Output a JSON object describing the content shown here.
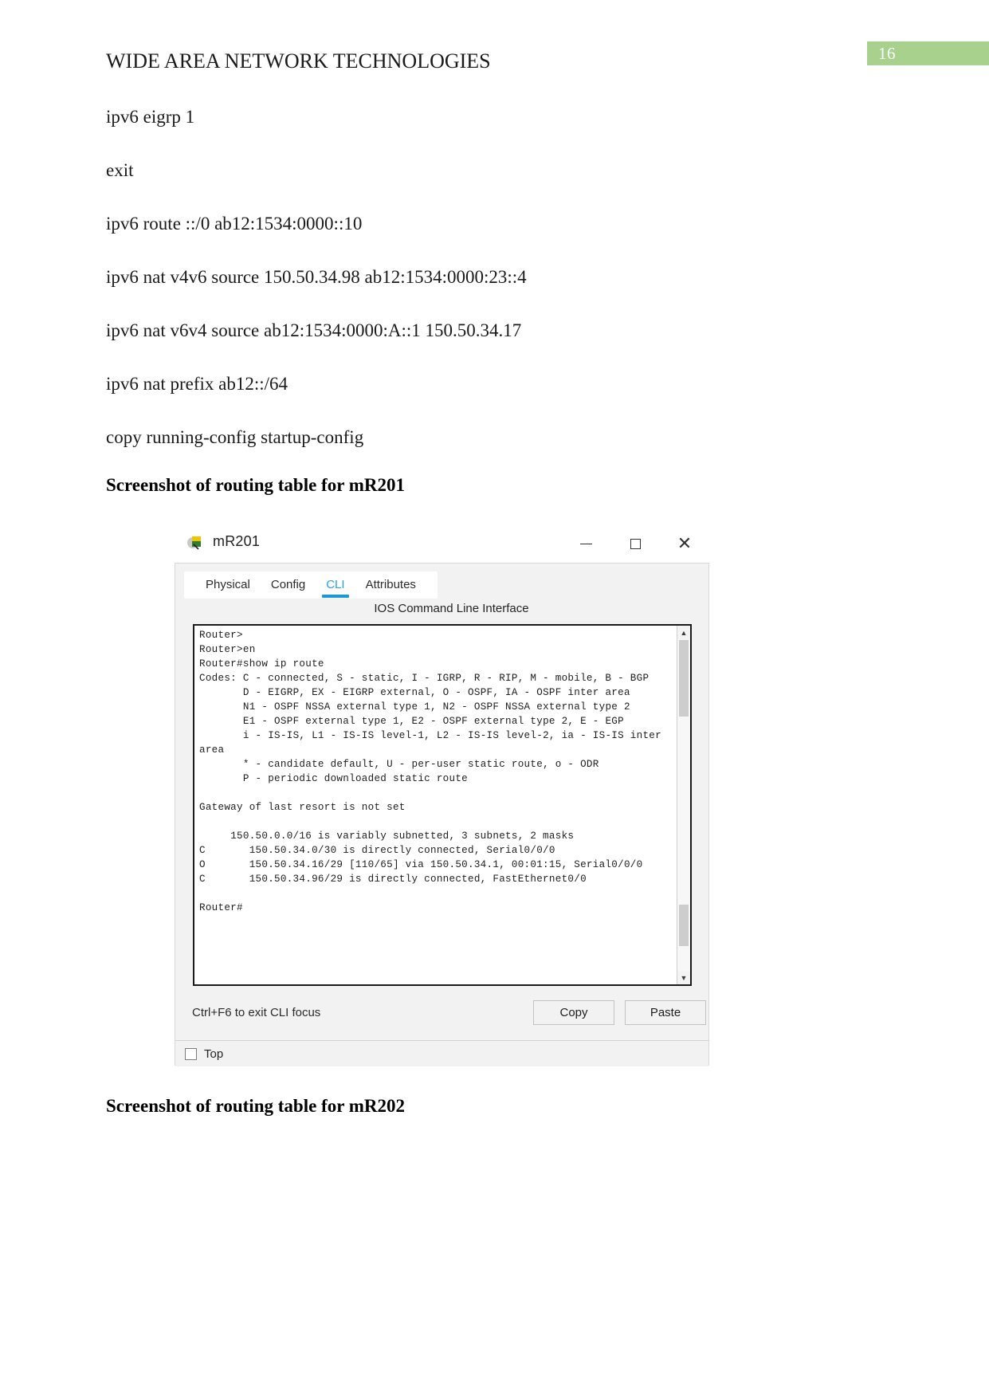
{
  "document": {
    "header_title": "WIDE AREA NETWORK TECHNOLOGIES",
    "page_number": "16",
    "page_number_bg": "#a9d18e",
    "config_lines": [
      "ipv6 eigrp 1",
      "exit",
      "ipv6 route ::/0 ab12:1534:0000::10",
      "ipv6 nat v4v6 source 150.50.34.98 ab12:1534:0000:23::4",
      "ipv6 nat v6v4 source ab12:1534:0000:A::1 150.50.34.17",
      "ipv6 nat prefix ab12::/64",
      "copy running-config startup-config"
    ],
    "heading_mr201": "Screenshot of routing table for mR201",
    "heading_mr202": "Screenshot of routing table for mR202"
  },
  "packet_tracer_window": {
    "title": "mR201",
    "app_icon": "packet-tracer-router-icon",
    "window_controls": {
      "minimize": "minimize-icon",
      "maximize": "maximize-icon",
      "close": "close-icon"
    },
    "tabs": [
      {
        "label": "Physical",
        "active": false
      },
      {
        "label": "Config",
        "active": false
      },
      {
        "label": "CLI",
        "active": true
      },
      {
        "label": "Attributes",
        "active": false
      }
    ],
    "subtitle": "IOS Command Line Interface",
    "terminal_text": "Router>\nRouter>en\nRouter#show ip route\nCodes: C - connected, S - static, I - IGRP, R - RIP, M - mobile, B - BGP\n       D - EIGRP, EX - EIGRP external, O - OSPF, IA - OSPF inter area\n       N1 - OSPF NSSA external type 1, N2 - OSPF NSSA external type 2\n       E1 - OSPF external type 1, E2 - OSPF external type 2, E - EGP\n       i - IS-IS, L1 - IS-IS level-1, L2 - IS-IS level-2, ia - IS-IS inter area\n       * - candidate default, U - per-user static route, o - ODR\n       P - periodic downloaded static route\n\nGateway of last resort is not set\n\n     150.50.0.0/16 is variably subnetted, 3 subnets, 2 masks\nC       150.50.34.0/30 is directly connected, Serial0/0/0\nO       150.50.34.16/29 [110/65] via 150.50.34.1, 00:01:15, Serial0/0/0\nC       150.50.34.96/29 is directly connected, FastEthernet0/0\n\nRouter#",
    "focus_hint": "Ctrl+F6 to exit CLI focus",
    "copy_button": "Copy",
    "paste_button": "Paste",
    "top_checkbox_label": "Top",
    "scroll_up_glyph": "▲",
    "scroll_down_glyph": "▼",
    "accent_color": "#1a9bd7"
  }
}
